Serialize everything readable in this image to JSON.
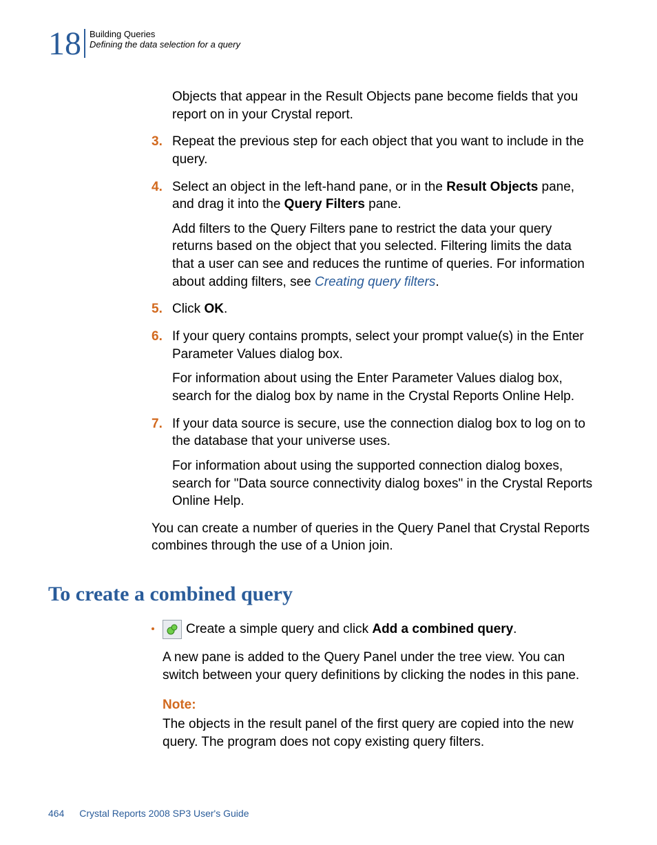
{
  "header": {
    "chapter_number": "18",
    "title": "Building Queries",
    "subtitle": "Defining the data selection for a query"
  },
  "body": {
    "intro_para": "Objects that appear in the Result Objects pane become fields that you report on in your Crystal report.",
    "step3_num": "3.",
    "step3_text": "Repeat the previous step for each object that you want to include in the query.",
    "step4_num": "4.",
    "step4_prefix": "Select an object in the left-hand pane, or in the ",
    "step4_bold1": "Result Objects",
    "step4_mid": " pane, and drag it into the ",
    "step4_bold2": "Query Filters",
    "step4_suffix": " pane.",
    "step4_para_prefix": "Add filters to the Query Filters pane to restrict the data your query returns based on the object that you selected. Filtering limits the data that a user can see and reduces the runtime of queries. For information about adding filters, see ",
    "step4_link": "Creating query filters",
    "step4_para_suffix": ".",
    "step5_num": "5.",
    "step5_prefix": "Click ",
    "step5_bold": "OK",
    "step5_suffix": ".",
    "step6_num": "6.",
    "step6_text": "If your query contains prompts, select your prompt value(s) in the Enter Parameter Values dialog box.",
    "step6_para": "For information about using the Enter Parameter Values dialog box, search for the dialog box by name in the Crystal Reports Online Help.",
    "step7_num": "7.",
    "step7_text": "If your data source is secure, use the connection dialog box to log on to the database that your universe uses.",
    "step7_para": "For information about using the supported connection dialog boxes, search for \"Data source connectivity dialog boxes\" in the Crystal Reports Online Help.",
    "closing_para": "You can create a number of queries in the Query Panel that Crystal Reports combines through the use of a Union join."
  },
  "section2": {
    "heading": "To create a combined query",
    "bullet_prefix": " Create a simple query and click ",
    "bullet_bold": "Add a combined query",
    "bullet_suffix": ".",
    "bullet_para": "A new pane is added to the Query Panel under the tree view. You can switch between your query definitions by clicking the nodes in this pane.",
    "note_label": "Note:",
    "note_text": "The objects in the result panel of the first query are copied into the new query. The program does not copy existing query filters."
  },
  "footer": {
    "page_number": "464",
    "doc_title": "Crystal Reports 2008 SP3 User's Guide"
  }
}
